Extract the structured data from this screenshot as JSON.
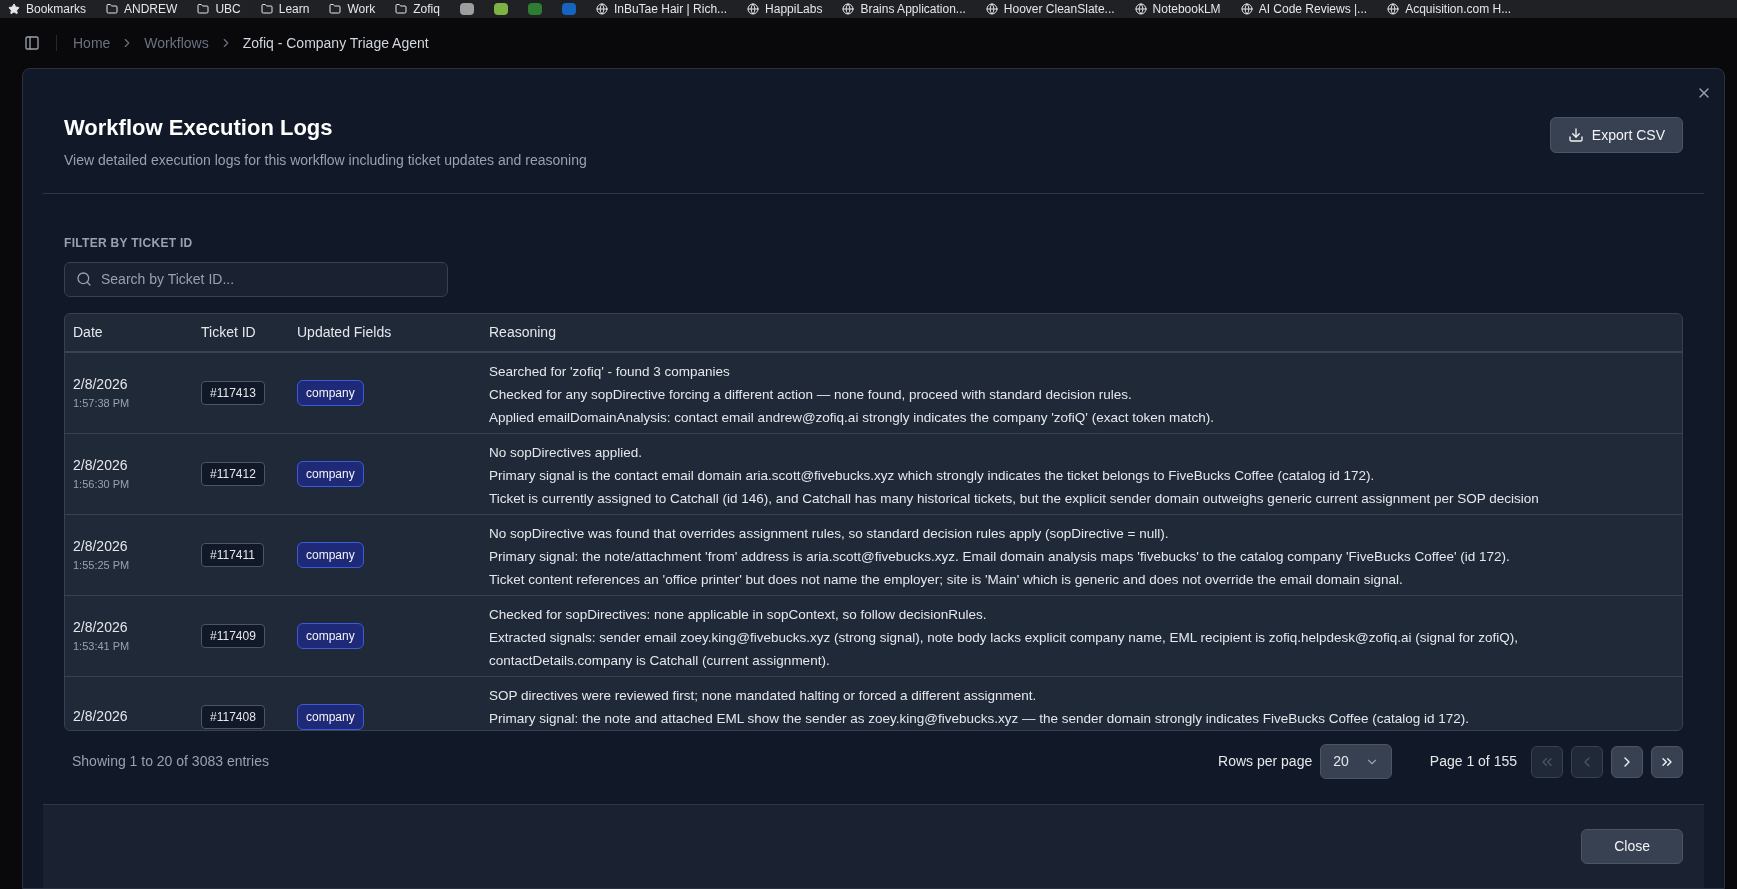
{
  "bookmarks_bar": [
    {
      "kind": "star",
      "label": "Bookmarks"
    },
    {
      "kind": "folder",
      "label": "ANDREW"
    },
    {
      "kind": "folder",
      "label": "UBC"
    },
    {
      "kind": "folder",
      "label": "Learn"
    },
    {
      "kind": "folder",
      "label": "Work"
    },
    {
      "kind": "folder",
      "label": "Zofiq"
    },
    {
      "kind": "favicon"
    },
    {
      "kind": "favicon"
    },
    {
      "kind": "favicon"
    },
    {
      "kind": "favicon"
    },
    {
      "kind": "site",
      "label": "InBuTae Hair | Rich..."
    },
    {
      "kind": "site",
      "label": "HappiLabs"
    },
    {
      "kind": "site",
      "label": "Brains Application..."
    },
    {
      "kind": "site",
      "label": "Hoover CleanSlate..."
    },
    {
      "kind": "site",
      "label": "NotebookLM"
    },
    {
      "kind": "site",
      "label": "AI Code Reviews |..."
    },
    {
      "kind": "site",
      "label": "Acquisition.com H..."
    }
  ],
  "breadcrumb": [
    {
      "label": "Home",
      "selected": false
    },
    {
      "label": "Workflows",
      "selected": false
    },
    {
      "label": "Zofiq - Company Triage Agent",
      "selected": true
    }
  ],
  "dialog": {
    "title": "Workflow Execution Logs",
    "subtitle": "View detailed execution logs for this workflow including ticket updates and reasoning",
    "export_button": "Export CSV",
    "filter": {
      "label": "FILTER BY TICKET ID",
      "placeholder": "Search by Ticket ID..."
    },
    "table": {
      "columns": [
        "Date",
        "Ticket ID",
        "Updated Fields",
        "Reasoning"
      ],
      "rows": [
        {
          "date": "2/8/2026",
          "time": "1:57:38 PM",
          "ticket": "#117413",
          "fields": [
            "company"
          ],
          "reasoning": [
            "Searched for 'zofiq' - found 3 companies",
            "Checked for any sopDirective forcing a different action — none found, proceed with standard decision rules.",
            "Applied emailDomainAnalysis: contact email andrew@zofiq.ai strongly indicates the company 'zofiQ' (exact token match)."
          ]
        },
        {
          "date": "2/8/2026",
          "time": "1:56:30 PM",
          "ticket": "#117412",
          "fields": [
            "company"
          ],
          "reasoning": [
            "No sopDirectives applied.",
            "Primary signal is the contact email domain aria.scott@fivebucks.xyz which strongly indicates the ticket belongs to FiveBucks Coffee (catalog id 172).",
            "Ticket is currently assigned to Catchall (id 146), and Catchall has many historical tickets, but the explicit sender domain outweighs generic current assignment per SOP decision"
          ]
        },
        {
          "date": "2/8/2026",
          "time": "1:55:25 PM",
          "ticket": "#117411",
          "fields": [
            "company"
          ],
          "reasoning": [
            "No sopDirective was found that overrides assignment rules, so standard decision rules apply (sopDirective = null).",
            "Primary signal: the note/attachment 'from' address is aria.scott@fivebucks.xyz. Email domain analysis maps 'fivebucks' to the catalog company 'FiveBucks Coffee' (id 172).",
            "Ticket content references an 'office printer' but does not name the employer; site is 'Main' which is generic and does not override the email domain signal."
          ]
        },
        {
          "date": "2/8/2026",
          "time": "1:53:41 PM",
          "ticket": "#117409",
          "fields": [
            "company"
          ],
          "reasoning": [
            "Checked for sopDirectives: none applicable in sopContext, so follow decisionRules.",
            "Extracted signals: sender email zoey.king@fivebucks.xyz (strong signal), note body lacks explicit company name, EML recipient is zofiq.helpdesk@zofiq.ai (signal for zofiQ),",
            "contactDetails.company is Catchall (current assignment)."
          ]
        },
        {
          "date": "2/8/2026",
          "ticket": "#117408",
          "fields": [
            "company"
          ],
          "reasoning": [
            "SOP directives were reviewed first; none mandated halting or forced a different assignment.",
            "Primary signal: the note and attached EML show the sender as zoey.king@fivebucks.xyz — the sender domain strongly indicates FiveBucks Coffee (catalog id 172)."
          ]
        }
      ]
    },
    "footer": {
      "summary": "Showing 1 to 20 of 3083 entries",
      "rows_per_page_label": "Rows per page",
      "rows_per_page": "20",
      "page": "Page 1 of 155",
      "nav": [
        {
          "kind": "first",
          "disabled": true
        },
        {
          "kind": "prev",
          "disabled": true
        },
        {
          "kind": "next",
          "disabled": false
        },
        {
          "kind": "last",
          "disabled": false
        }
      ]
    },
    "close_button": "Close"
  }
}
